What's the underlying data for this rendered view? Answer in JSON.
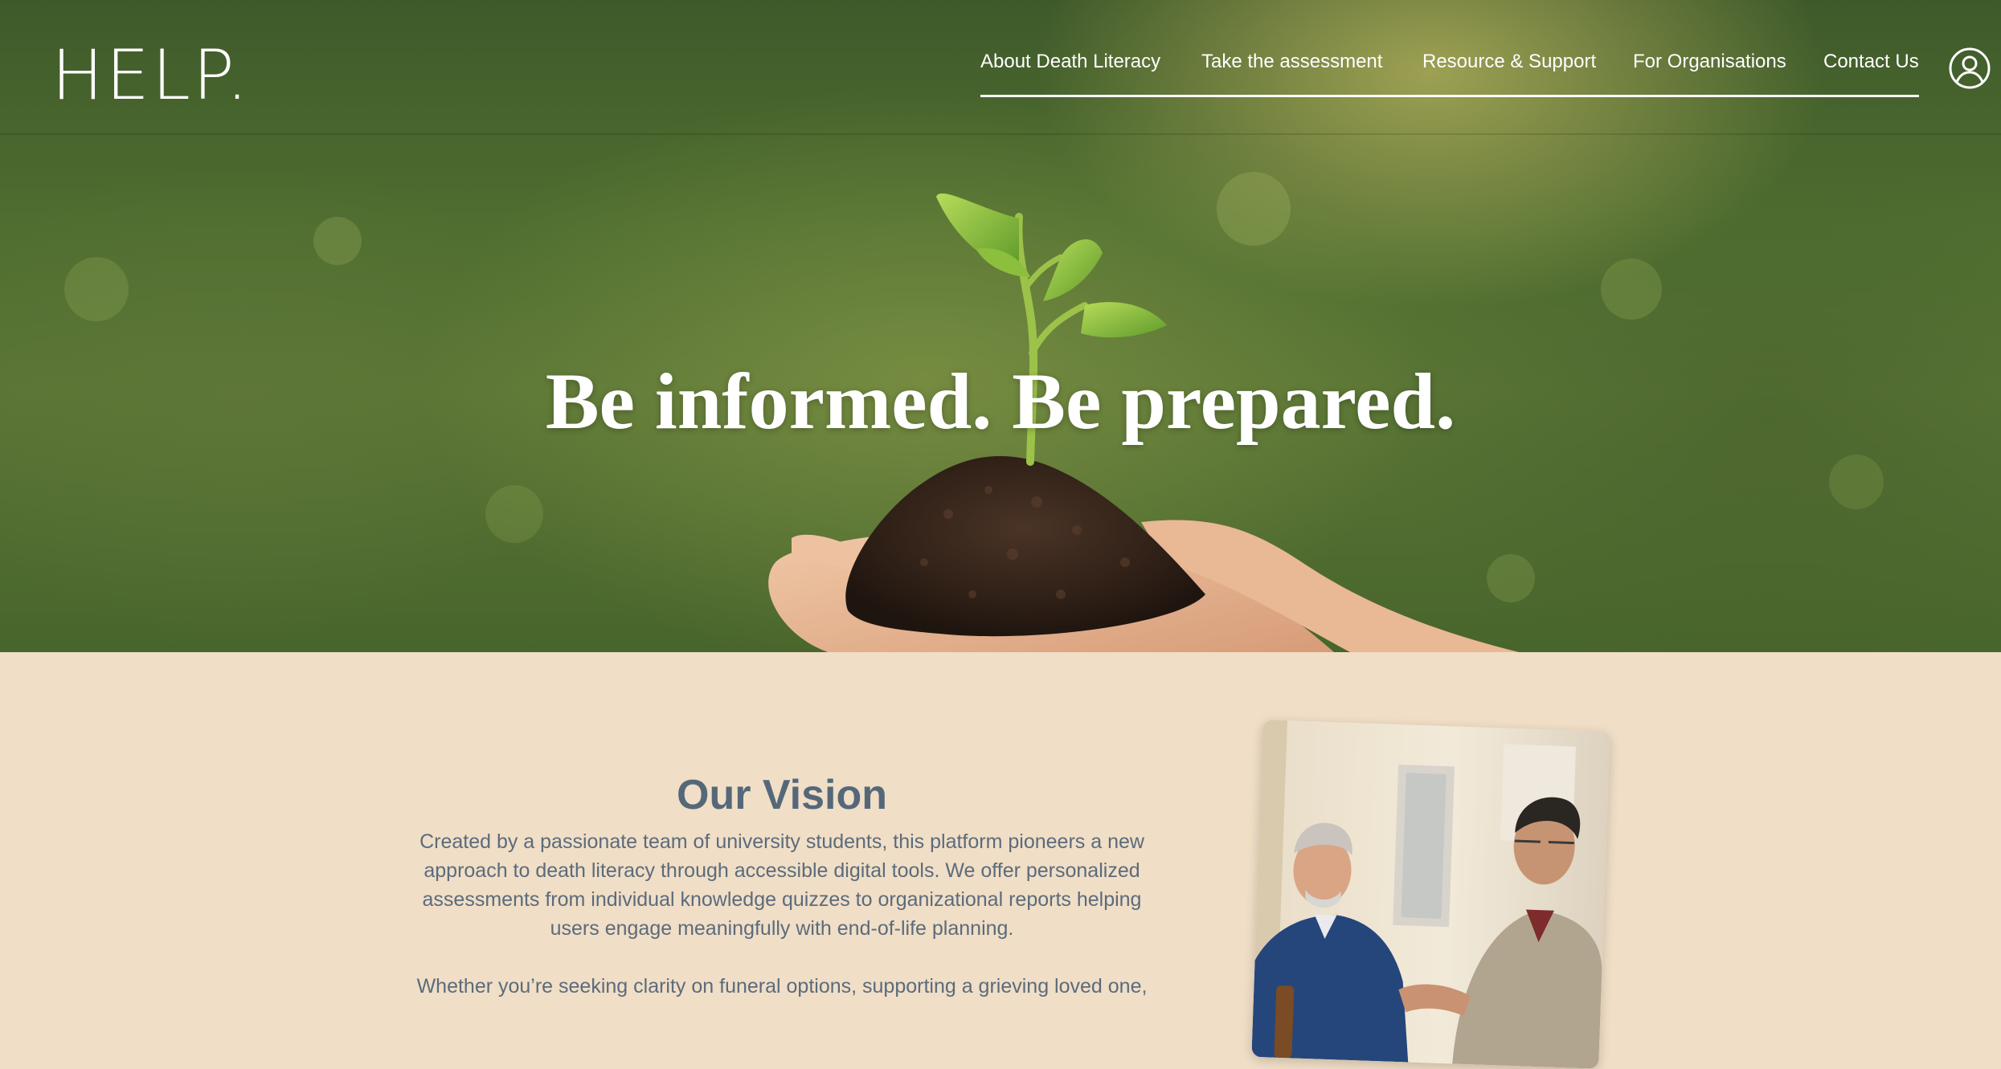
{
  "header": {
    "logo": "HELP.",
    "nav": [
      {
        "label": "About Death Literacy"
      },
      {
        "label": "Take the assessment"
      },
      {
        "label": "Resource & Support"
      },
      {
        "label": "For Organisations"
      },
      {
        "label": "Contact Us"
      }
    ],
    "account_icon": "user-circle-icon"
  },
  "hero": {
    "title": "Be informed. Be prepared.",
    "image": "seedling-in-hands"
  },
  "vision": {
    "title": "Our Vision",
    "paragraph1": "Created by a passionate team of university students, this platform pioneers a new approach to death literacy through accessible digital tools. We offer personalized assessments from individual knowledge quizzes to organizational reports helping users engage meaningfully with end-of-life planning.",
    "paragraph2": "Whether you’re seeking clarity on funeral options, supporting a grieving loved one,",
    "image": "two-men-talking-photo"
  },
  "colors": {
    "page_background": "#f0dec6",
    "heading": "#55687a",
    "body_text": "#5b6b7c",
    "hero_text": "#ffffff"
  }
}
